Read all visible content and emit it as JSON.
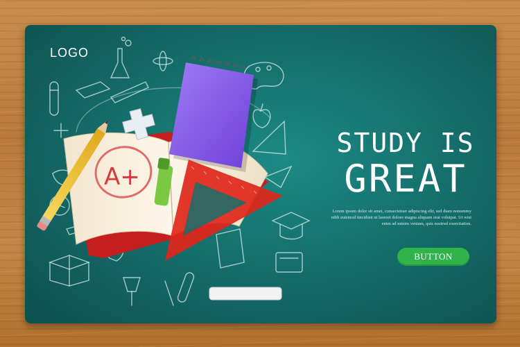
{
  "header": {
    "logo_text": "LOGO"
  },
  "hero": {
    "title_line1": "STUDY IS",
    "title_line2": "GREAT",
    "body_text": "Lorem ipsum dolor sit amet, consectetuer adipiscing elit, sed diam nonummy nibh euismod tincidunt ut laoreet dolore magna aliquam erat volutpat. Ut wisi enim ad minim veniam, quis nostrud exercitation.",
    "button_label": "BUTTON",
    "grade_text": "A+"
  },
  "colors": {
    "board": "#156f6c",
    "button": "#2fb34a",
    "notebook": "#8b5cf0",
    "triangle": "#e0261b",
    "highlighter": "#7ac943",
    "pencil": "#f2c230"
  },
  "illustration": {
    "items": [
      "open-book",
      "spiral-notebook",
      "triangle-ruler",
      "pencil",
      "highlighter",
      "eraser",
      "plus-cross",
      "chalk",
      "doodles"
    ]
  }
}
